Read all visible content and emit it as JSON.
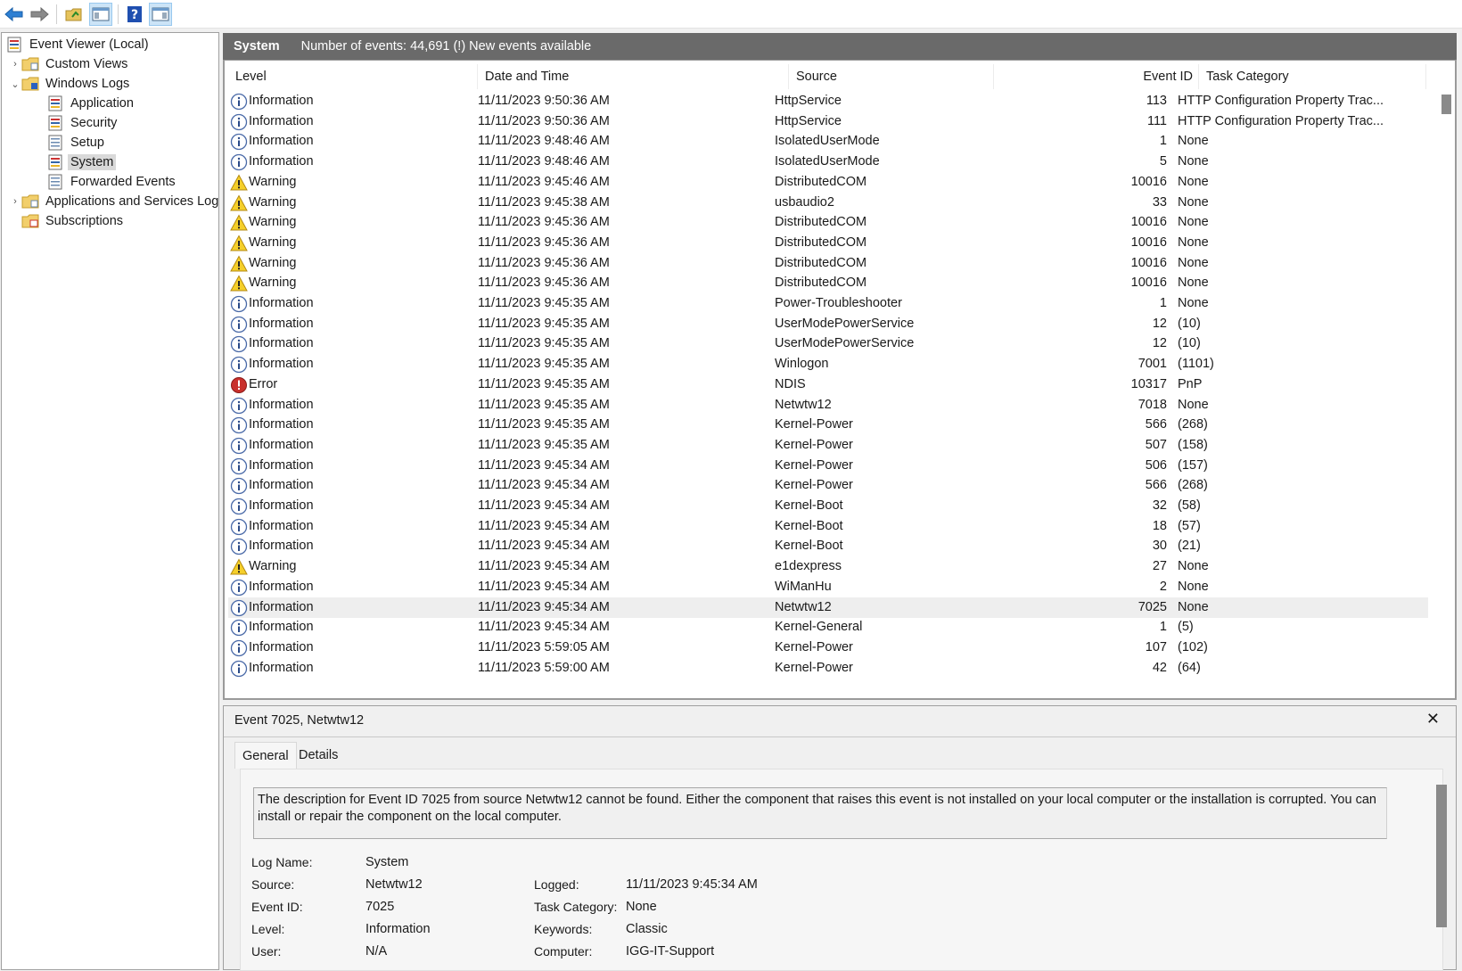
{
  "toolbar": {
    "buttons": [
      {
        "icon": "back-arrow-icon"
      },
      {
        "icon": "forward-arrow-icon"
      },
      {
        "icon": "open-folder-icon"
      },
      {
        "icon": "show-hide-console-tree-icon"
      },
      {
        "icon": "help-icon"
      },
      {
        "icon": "show-hide-action-pane-icon"
      }
    ]
  },
  "tree": {
    "root": "Event Viewer (Local)",
    "custom_views": "Custom Views",
    "windows_logs": "Windows Logs",
    "application": "Application",
    "security": "Security",
    "setup": "Setup",
    "system": "System",
    "forwarded_events": "Forwarded Events",
    "apps_services_logs": "Applications and Services Logs",
    "subscriptions": "Subscriptions"
  },
  "list": {
    "title": "System",
    "summary": "Number of events: 44,691 (!) New events available",
    "columns": {
      "level": "Level",
      "date_time": "Date and Time",
      "source": "Source",
      "event_id": "Event ID",
      "task_category": "Task Category"
    },
    "rows": [
      {
        "level": "Information",
        "type": "info",
        "date": "11/11/2023 9:50:36 AM",
        "source": "HttpService",
        "event_id": "113",
        "task": "HTTP Configuration Property Trac..."
      },
      {
        "level": "Information",
        "type": "info",
        "date": "11/11/2023 9:50:36 AM",
        "source": "HttpService",
        "event_id": "111",
        "task": "HTTP Configuration Property Trac..."
      },
      {
        "level": "Information",
        "type": "info",
        "date": "11/11/2023 9:48:46 AM",
        "source": "IsolatedUserMode",
        "event_id": "1",
        "task": "None"
      },
      {
        "level": "Information",
        "type": "info",
        "date": "11/11/2023 9:48:46 AM",
        "source": "IsolatedUserMode",
        "event_id": "5",
        "task": "None"
      },
      {
        "level": "Warning",
        "type": "warn",
        "date": "11/11/2023 9:45:46 AM",
        "source": "DistributedCOM",
        "event_id": "10016",
        "task": "None"
      },
      {
        "level": "Warning",
        "type": "warn",
        "date": "11/11/2023 9:45:38 AM",
        "source": "usbaudio2",
        "event_id": "33",
        "task": "None"
      },
      {
        "level": "Warning",
        "type": "warn",
        "date": "11/11/2023 9:45:36 AM",
        "source": "DistributedCOM",
        "event_id": "10016",
        "task": "None"
      },
      {
        "level": "Warning",
        "type": "warn",
        "date": "11/11/2023 9:45:36 AM",
        "source": "DistributedCOM",
        "event_id": "10016",
        "task": "None"
      },
      {
        "level": "Warning",
        "type": "warn",
        "date": "11/11/2023 9:45:36 AM",
        "source": "DistributedCOM",
        "event_id": "10016",
        "task": "None"
      },
      {
        "level": "Warning",
        "type": "warn",
        "date": "11/11/2023 9:45:36 AM",
        "source": "DistributedCOM",
        "event_id": "10016",
        "task": "None"
      },
      {
        "level": "Information",
        "type": "info",
        "date": "11/11/2023 9:45:35 AM",
        "source": "Power-Troubleshooter",
        "event_id": "1",
        "task": "None"
      },
      {
        "level": "Information",
        "type": "info",
        "date": "11/11/2023 9:45:35 AM",
        "source": "UserModePowerService",
        "event_id": "12",
        "task": "(10)"
      },
      {
        "level": "Information",
        "type": "info",
        "date": "11/11/2023 9:45:35 AM",
        "source": "UserModePowerService",
        "event_id": "12",
        "task": "(10)"
      },
      {
        "level": "Information",
        "type": "info",
        "date": "11/11/2023 9:45:35 AM",
        "source": "Winlogon",
        "event_id": "7001",
        "task": "(1101)"
      },
      {
        "level": "Error",
        "type": "error",
        "date": "11/11/2023 9:45:35 AM",
        "source": "NDIS",
        "event_id": "10317",
        "task": "PnP"
      },
      {
        "level": "Information",
        "type": "info",
        "date": "11/11/2023 9:45:35 AM",
        "source": "Netwtw12",
        "event_id": "7018",
        "task": "None"
      },
      {
        "level": "Information",
        "type": "info",
        "date": "11/11/2023 9:45:35 AM",
        "source": "Kernel-Power",
        "event_id": "566",
        "task": "(268)"
      },
      {
        "level": "Information",
        "type": "info",
        "date": "11/11/2023 9:45:35 AM",
        "source": "Kernel-Power",
        "event_id": "507",
        "task": "(158)"
      },
      {
        "level": "Information",
        "type": "info",
        "date": "11/11/2023 9:45:34 AM",
        "source": "Kernel-Power",
        "event_id": "506",
        "task": "(157)"
      },
      {
        "level": "Information",
        "type": "info",
        "date": "11/11/2023 9:45:34 AM",
        "source": "Kernel-Power",
        "event_id": "566",
        "task": "(268)"
      },
      {
        "level": "Information",
        "type": "info",
        "date": "11/11/2023 9:45:34 AM",
        "source": "Kernel-Boot",
        "event_id": "32",
        "task": "(58)"
      },
      {
        "level": "Information",
        "type": "info",
        "date": "11/11/2023 9:45:34 AM",
        "source": "Kernel-Boot",
        "event_id": "18",
        "task": "(57)"
      },
      {
        "level": "Information",
        "type": "info",
        "date": "11/11/2023 9:45:34 AM",
        "source": "Kernel-Boot",
        "event_id": "30",
        "task": "(21)"
      },
      {
        "level": "Warning",
        "type": "warn",
        "date": "11/11/2023 9:45:34 AM",
        "source": "e1dexpress",
        "event_id": "27",
        "task": "None"
      },
      {
        "level": "Information",
        "type": "info",
        "date": "11/11/2023 9:45:34 AM",
        "source": "WiManHu",
        "event_id": "2",
        "task": "None"
      },
      {
        "level": "Information",
        "type": "info",
        "date": "11/11/2023 9:45:34 AM",
        "source": "Netwtw12",
        "event_id": "7025",
        "task": "None",
        "selected": true
      },
      {
        "level": "Information",
        "type": "info",
        "date": "11/11/2023 9:45:34 AM",
        "source": "Kernel-General",
        "event_id": "1",
        "task": "(5)"
      },
      {
        "level": "Information",
        "type": "info",
        "date": "11/11/2023 5:59:05 AM",
        "source": "Kernel-Power",
        "event_id": "107",
        "task": "(102)"
      },
      {
        "level": "Information",
        "type": "info",
        "date": "11/11/2023 5:59:00 AM",
        "source": "Kernel-Power",
        "event_id": "42",
        "task": "(64)"
      }
    ]
  },
  "detail": {
    "title": "Event 7025, Netwtw12",
    "close": "✕",
    "tabs": {
      "general": "General",
      "details": "Details"
    },
    "description": "The description for Event ID 7025 from source Netwtw12 cannot be found. Either the component that raises this event is not installed on your local computer or the installation is corrupted. You can install or repair the component on the local computer.",
    "labels": {
      "log_name": "Log Name:",
      "source": "Source:",
      "event_id": "Event ID:",
      "level": "Level:",
      "user": "User:",
      "logged": "Logged:",
      "task_category": "Task Category:",
      "keywords": "Keywords:",
      "computer": "Computer:"
    },
    "values": {
      "log_name": "System",
      "source": "Netwtw12",
      "event_id": "7025",
      "level": "Information",
      "user": "N/A",
      "logged": "11/11/2023 9:45:34 AM",
      "task_category": "None",
      "keywords": "Classic",
      "computer": "IGG-IT-Support"
    }
  }
}
